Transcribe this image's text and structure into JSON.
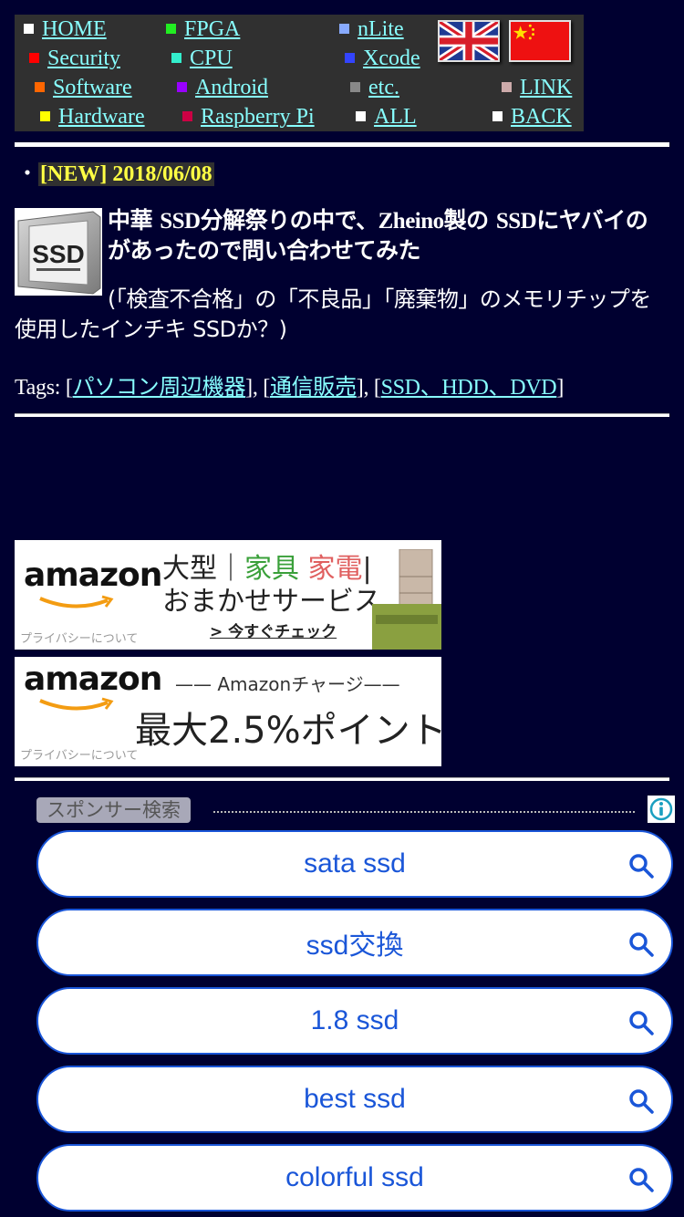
{
  "nav": {
    "items": [
      {
        "label": "HOME",
        "color": "#ffffff"
      },
      {
        "label": "FPGA",
        "color": "#22ee22"
      },
      {
        "label": "nLite",
        "color": "#88aaff"
      },
      {
        "label": "Security",
        "color": "#ff0000"
      },
      {
        "label": "CPU",
        "color": "#33eecc"
      },
      {
        "label": "Xcode",
        "color": "#3344ff"
      },
      {
        "label": "Software",
        "color": "#ff6600"
      },
      {
        "label": "Android",
        "color": "#9900ff"
      },
      {
        "label": "etc.",
        "color": "#888888"
      },
      {
        "label": "LINK",
        "color": "#ccaaaa"
      },
      {
        "label": "Hardware",
        "color": "#ffff00"
      },
      {
        "label": "Raspberry Pi",
        "color": "#cc0044"
      },
      {
        "label": "ALL",
        "color": "#ffffff"
      },
      {
        "label": "BACK",
        "color": "#ffffff"
      }
    ],
    "flags": [
      "uk-flag",
      "china-flag"
    ]
  },
  "post": {
    "bullet": "・",
    "new_badge": "[NEW] 2018/06/08",
    "thumb_text": "SSD",
    "title_parts": [
      "中華 ",
      "SSD",
      "分解祭りの中で、",
      "Zheino",
      "製の ",
      "SSD",
      "にヤバイのがあったので問い合わせてみた"
    ],
    "description": "(「検査不合格」の「不良品」「廃棄物」のメモリチップを使用したインチキ SSDか？)",
    "tags_label": "Tags: ",
    "tags": [
      "パソコン周辺機器",
      "通信販売",
      "SSD、HDD、DVD"
    ]
  },
  "ads": [
    {
      "logo": "amazon",
      "line1_a": "大型｜",
      "line1_b": "家具",
      "line1_c": "家電",
      "line1_d": "|",
      "line2": "おまかせサービス",
      "cta": "> 今すぐチェック",
      "privacy": "プライバシーについて"
    },
    {
      "logo": "amazon",
      "subtitle": "—— Amazonチャージ——",
      "headline": "最大2.5%ポイント",
      "privacy": "プライバシーについて"
    }
  ],
  "sponsor": {
    "label": "スポンサー検索",
    "searches": [
      "sata ssd",
      "ssd交換",
      "1.8 ssd",
      "best ssd",
      "colorful ssd"
    ]
  }
}
